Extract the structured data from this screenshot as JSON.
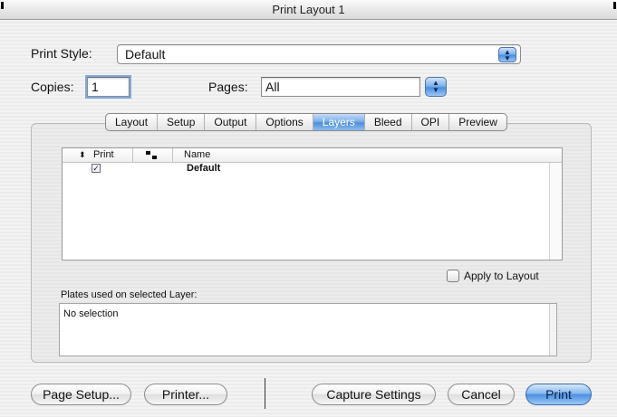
{
  "window": {
    "title": "Print Layout 1"
  },
  "print_style": {
    "label": "Print Style:",
    "value": "Default"
  },
  "copies": {
    "label": "Copies:",
    "value": "1"
  },
  "pages": {
    "label": "Pages:",
    "value": "All"
  },
  "tabs": [
    {
      "label": "Layout",
      "selected": false
    },
    {
      "label": "Setup",
      "selected": false
    },
    {
      "label": "Output",
      "selected": false
    },
    {
      "label": "Options",
      "selected": false
    },
    {
      "label": "Layers",
      "selected": true
    },
    {
      "label": "Bleed",
      "selected": false
    },
    {
      "label": "OPI",
      "selected": false
    },
    {
      "label": "Preview",
      "selected": false
    }
  ],
  "layers_list": {
    "columns": {
      "print": "Print",
      "name": "Name"
    },
    "rows": [
      {
        "print_checked": true,
        "name": "Default"
      }
    ]
  },
  "apply_to_layout": {
    "label": "Apply to Layout",
    "checked": false
  },
  "plates": {
    "label": "Plates used on selected Layer:",
    "value": "No selection"
  },
  "buttons": {
    "page_setup": "Page Setup...",
    "printer": "Printer...",
    "capture_settings": "Capture Settings",
    "cancel": "Cancel",
    "print": "Print"
  },
  "colors": {
    "accent": "#4c8ee0",
    "border": "#8c8c8c"
  }
}
